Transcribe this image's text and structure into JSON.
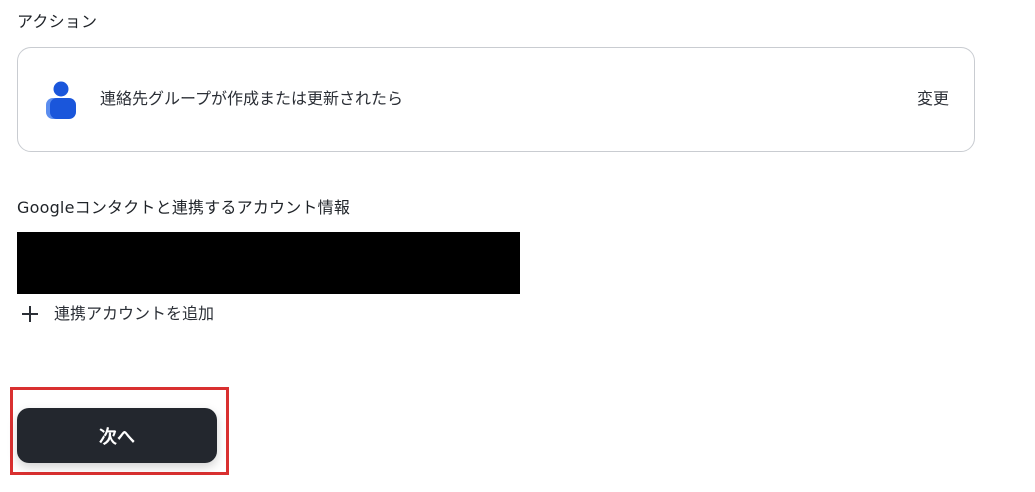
{
  "action_section": {
    "label": "アクション",
    "card": {
      "icon": "contact-person-icon",
      "text": "連絡先グループが作成または更新されたら",
      "change_label": "変更"
    }
  },
  "account_section": {
    "label": "Googleコンタクトと連携するアカウント情報",
    "add_account_label": "連携アカウントを追加",
    "add_icon": "plus-icon"
  },
  "footer": {
    "next_label": "次へ"
  },
  "colors": {
    "icon_primary": "#1a56db",
    "icon_secondary": "#5b8def",
    "button_bg": "#23272e",
    "highlight": "#d93030"
  }
}
